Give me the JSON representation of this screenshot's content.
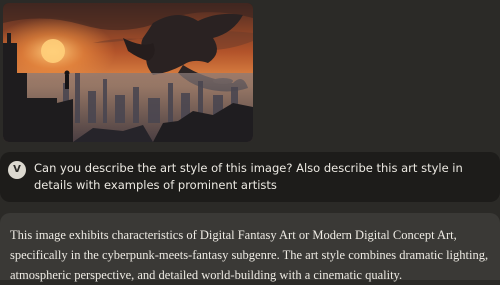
{
  "attachment": {
    "icon": "fantasy-dragon-city-image"
  },
  "user_message": {
    "avatar_initial": "V",
    "text": "Can you describe the art style of this image? Also describe this art style in details with examples of prominent artists"
  },
  "assistant_message": {
    "text": "This image exhibits characteristics of Digital Fantasy Art or Modern Digital Concept Art, specifically in the cyberpunk-meets-fantasy subgenre. The art style combines dramatic lighting, atmospheric perspective, and detailed world-building with a cinematic quality."
  },
  "colors": {
    "background": "#2b2a27",
    "user_bubble": "#1d1c1a",
    "assistant_bubble": "#3a3936",
    "avatar": "#dcd9d0",
    "sky_orange": "#e07a3a"
  }
}
